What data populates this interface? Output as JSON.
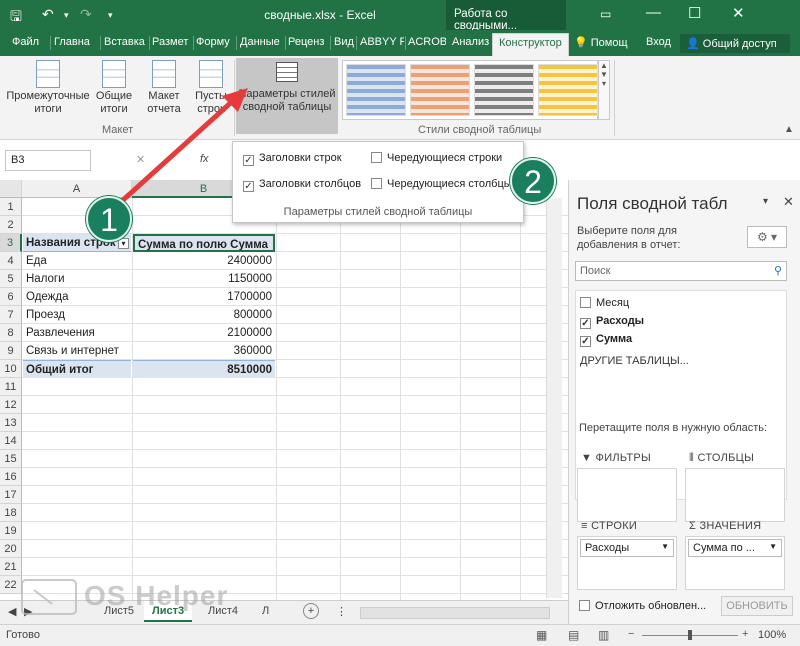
{
  "titlebar": {
    "title": "сводные.xlsx - Excel",
    "contextual": "Работа со сводными..."
  },
  "tabs": [
    "Файл",
    "Главна",
    "Вставка",
    "Размет",
    "Форму",
    "Данные",
    "Реценз",
    "Вид",
    "ABBYY F",
    "ACROB",
    "Анализ",
    "Конструктор"
  ],
  "tabs_right": {
    "help": "Помощ",
    "login": "Вход",
    "share": "Общий доступ"
  },
  "ribbon": {
    "subtotals": "Промежуточные итоги",
    "grand_totals": "Общие итоги",
    "report_layout": "Макет отчета",
    "blank_rows": "Пусты строк",
    "layout_group": "Макет",
    "style_params": "Параметры стилей сводной таблицы",
    "styles_group": "Стили сводной таблицы"
  },
  "style_options": {
    "row_headers": "Заголовки строк",
    "col_headers": "Заголовки столбцов",
    "banded_rows": "Чередующиеся строки",
    "banded_cols": "Чередующиеся столбцы",
    "footer": "Параметры стилей сводной таблицы"
  },
  "formulabar": {
    "namebox": "B3",
    "fx": "fx"
  },
  "columns": [
    "A",
    "B"
  ],
  "rows": [
    "1",
    "2",
    "3",
    "4",
    "5",
    "6",
    "7",
    "8",
    "9",
    "10",
    "11",
    "12",
    "13",
    "14",
    "15",
    "16",
    "17",
    "18",
    "19",
    "20",
    "21",
    "22"
  ],
  "pivot": {
    "header_rows": "Названия строк",
    "header_sum": "Сумма по полю Сумма",
    "items": [
      {
        "name": "Еда",
        "value": "2400000"
      },
      {
        "name": "Налоги",
        "value": "1150000"
      },
      {
        "name": "Одежда",
        "value": "1700000"
      },
      {
        "name": "Проезд",
        "value": "800000"
      },
      {
        "name": "Развлечения",
        "value": "2100000"
      },
      {
        "name": "Связь и интернет",
        "value": "360000"
      }
    ],
    "total_label": "Общий итог",
    "total_value": "8510000"
  },
  "sheets": {
    "s1": "Лист5",
    "s2": "Лист3",
    "s3": "Лист4",
    "s4": "Л",
    "add": "+"
  },
  "status": {
    "ready": "Готово",
    "zoom": "100%"
  },
  "pane": {
    "title": "Поля сводной табл",
    "subtitle": "Выберите поля для добавления в отчет:",
    "search": "Поиск",
    "fields": [
      {
        "label": "Месяц",
        "checked": ""
      },
      {
        "label": "Расходы",
        "checked": "✓"
      },
      {
        "label": "Сумма",
        "checked": "✓"
      }
    ],
    "other_tables": "ДРУГИЕ ТАБЛИЦЫ...",
    "drag_hint": "Перетащите поля в нужную область:",
    "filters": "ФИЛЬТРЫ",
    "columns": "СТОЛБЦЫ",
    "rows": "СТРОКИ",
    "values": "ЗНАЧЕНИЯ",
    "rows_value": "Расходы",
    "values_value": "Сумма по ...",
    "defer": "Отложить обновлен...",
    "update": "ОБНОВИТЬ"
  },
  "callouts": {
    "one": "1",
    "two": "2"
  },
  "watermark": "OS Helper",
  "accent": "#217346",
  "callout_color": "#1a7f5e",
  "arrow_color": "#e43c3c"
}
